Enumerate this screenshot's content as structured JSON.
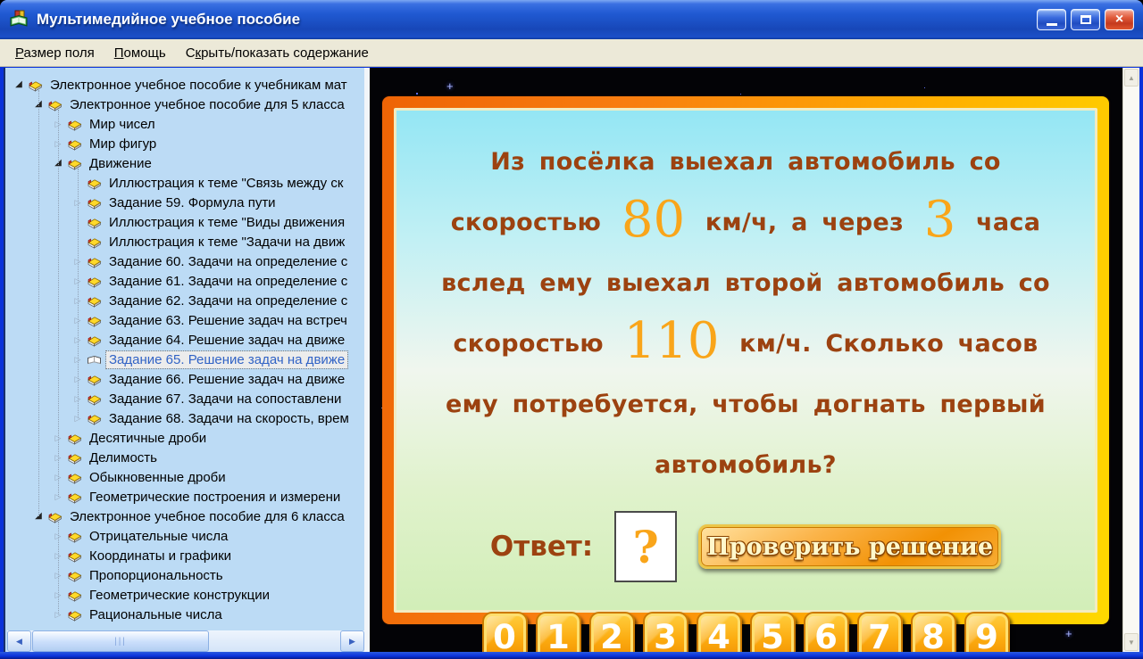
{
  "palette": {
    "title_blue": "#2059d2",
    "close_red": "#c43a1e",
    "menu_bg": "#ece9d8",
    "tree_bg": "#bcdbf5",
    "selected_text": "#3163c5",
    "stage_black": "#030306",
    "card_border_orange": "#ee6405",
    "card_border_yellow": "#ffd900",
    "card_top_cyan": "#94e6f4",
    "card_bottom_green": "#d2eeb8",
    "text_brown": "#9c4210",
    "number_orange": "#f9a51a",
    "button_orange": "#f29104",
    "digit_text": "#ffffff"
  },
  "window": {
    "title": "Мультимедийное учебное пособие",
    "icon": "books-icon",
    "controls": [
      "minimize",
      "maximize",
      "close"
    ]
  },
  "menu": {
    "items": [
      {
        "label": "Размер поля",
        "accel": 0
      },
      {
        "label": "Помощь",
        "accel": 0
      },
      {
        "label": "Скрыть/показать содержание",
        "accel": 1
      }
    ]
  },
  "tree": {
    "items": [
      {
        "label": "Электронное учебное пособие к учебникам мат",
        "level": 0,
        "expander": "expanded",
        "selected": false
      },
      {
        "label": "Электронное учебное пособие для 5 класса",
        "level": 1,
        "expander": "expanded",
        "selected": false
      },
      {
        "label": "Мир чисел",
        "level": 2,
        "expander": "collapsed",
        "selected": false
      },
      {
        "label": "Мир фигур",
        "level": 2,
        "expander": "collapsed",
        "selected": false
      },
      {
        "label": "Движение",
        "level": 2,
        "expander": "expanded",
        "selected": false
      },
      {
        "label": "Иллюстрация к теме \"Связь между ск",
        "level": 3,
        "expander": "none",
        "selected": false
      },
      {
        "label": "Задание 59. Формула пути",
        "level": 3,
        "expander": "collapsed",
        "selected": false
      },
      {
        "label": "Иллюстрация к теме \"Виды движения",
        "level": 3,
        "expander": "none",
        "selected": false
      },
      {
        "label": "Иллюстрация к теме \"Задачи на движ",
        "level": 3,
        "expander": "none",
        "selected": false
      },
      {
        "label": "Задание 60. Задачи на определение с",
        "level": 3,
        "expander": "collapsed",
        "selected": false
      },
      {
        "label": "Задание 61. Задачи на определение с",
        "level": 3,
        "expander": "collapsed",
        "selected": false
      },
      {
        "label": "Задание 62. Задачи на определение с",
        "level": 3,
        "expander": "collapsed",
        "selected": false
      },
      {
        "label": "Задание 63. Решение задач на встреч",
        "level": 3,
        "expander": "collapsed",
        "selected": false
      },
      {
        "label": "Задание 64. Решение задач на движе",
        "level": 3,
        "expander": "collapsed",
        "selected": false
      },
      {
        "label": "Задание 65. Решение задач на движе",
        "level": 3,
        "expander": "collapsed",
        "selected": true
      },
      {
        "label": "Задание 66. Решение задач на движе",
        "level": 3,
        "expander": "collapsed",
        "selected": false
      },
      {
        "label": "Задание 67. Задачи на сопоставлени",
        "level": 3,
        "expander": "collapsed",
        "selected": false
      },
      {
        "label": "Задание 68. Задачи на скорость, врем",
        "level": 3,
        "expander": "collapsed",
        "selected": false
      },
      {
        "label": "Десятичные дроби",
        "level": 2,
        "expander": "collapsed",
        "selected": false
      },
      {
        "label": "Делимость",
        "level": 2,
        "expander": "collapsed",
        "selected": false
      },
      {
        "label": "Обыкновенные дроби",
        "level": 2,
        "expander": "collapsed",
        "selected": false
      },
      {
        "label": "Геометрические построения и измерени",
        "level": 2,
        "expander": "collapsed",
        "selected": false
      },
      {
        "label": "Электронное учебное пособие для 6 класса",
        "level": 1,
        "expander": "expanded",
        "selected": false
      },
      {
        "label": "Отрицательные числа",
        "level": 2,
        "expander": "collapsed",
        "selected": false
      },
      {
        "label": "Координаты и графики",
        "level": 2,
        "expander": "collapsed",
        "selected": false
      },
      {
        "label": "Пропорциональность",
        "level": 2,
        "expander": "collapsed",
        "selected": false
      },
      {
        "label": "Геометрические конструкции",
        "level": 2,
        "expander": "collapsed",
        "selected": false
      },
      {
        "label": "Рациональные числа",
        "level": 2,
        "expander": "collapsed",
        "selected": false
      }
    ]
  },
  "problem": {
    "segments": [
      {
        "t": "Из посёлка выехал автомобиль со скоростью ",
        "style": "normal"
      },
      {
        "t": "80",
        "style": "big"
      },
      {
        "t": " км/ч, а через ",
        "style": "normal"
      },
      {
        "t": "3",
        "style": "big"
      },
      {
        "t": " часа вслед ему выехал второй автомобиль со скоростью ",
        "style": "normal"
      },
      {
        "t": "110",
        "style": "big"
      },
      {
        "t": " км/ч. Сколько часов ему потребуется, чтобы догнать первый автомобиль?",
        "style": "normal"
      }
    ]
  },
  "answer": {
    "label": "Ответ:",
    "value": "?",
    "check_button": "Проверить решение"
  },
  "keypad": {
    "digits": [
      "0",
      "1",
      "2",
      "3",
      "4",
      "5",
      "6",
      "7",
      "8",
      "9"
    ]
  }
}
